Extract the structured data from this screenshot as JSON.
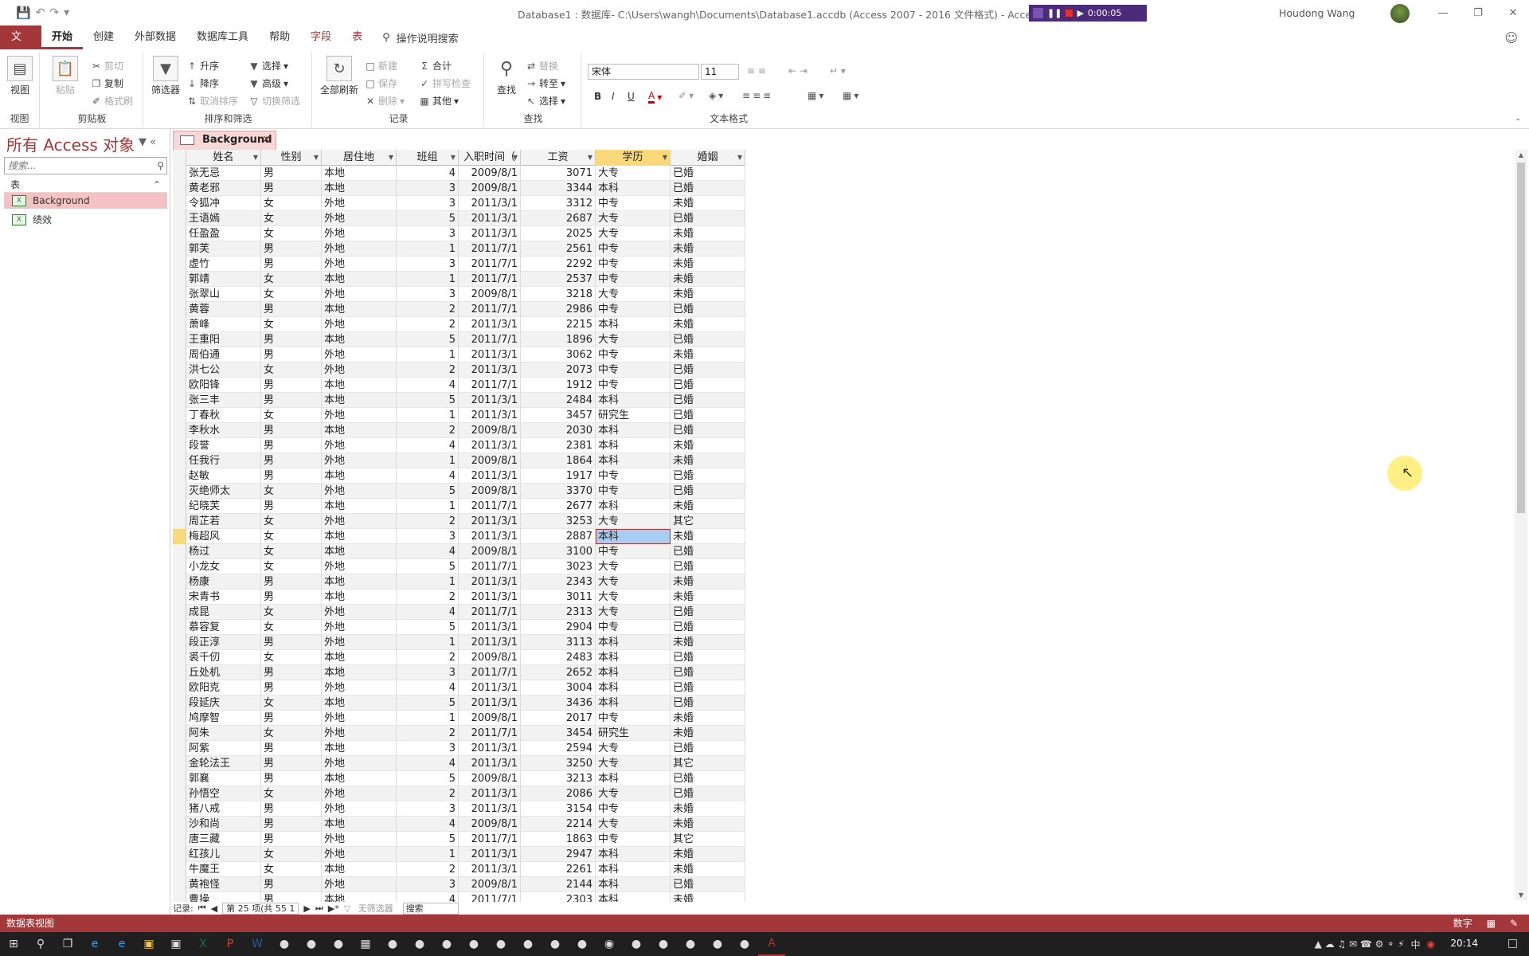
{
  "title": {
    "window_title": "Database1 : 数据库- C:\\Users\\wangh\\Documents\\Database1.accdb (Access 2007 - 2016 文件格式) - Access",
    "user": "Houdong Wang",
    "recorder_time": "0:00:05"
  },
  "menu": {
    "file": "文件",
    "tabs": [
      "开始",
      "创建",
      "外部数据",
      "数据库工具",
      "帮助",
      "字段",
      "表"
    ],
    "tell_me": "操作说明搜索"
  },
  "ribbon": {
    "view": {
      "btn": "视图",
      "label": "视图"
    },
    "clipboard": {
      "paste": "粘贴",
      "cut": "剪切",
      "copy": "复制",
      "format_painter": "格式刷",
      "label": "剪贴板"
    },
    "sort": {
      "filter": "筛选器",
      "asc": "升序",
      "desc": "降序",
      "clear_sort": "取消排序",
      "selection": "选择",
      "advanced": "高级",
      "toggle_filter": "切换筛选",
      "label": "排序和筛选"
    },
    "records": {
      "refresh": "全部刷新",
      "new": "新建",
      "save": "保存",
      "delete": "删除",
      "totals": "合计",
      "spelling": "拼写检查",
      "more": "其他",
      "label": "记录"
    },
    "find": {
      "find": "查找",
      "replace": "替换",
      "goto": "转至",
      "select": "选择",
      "label": "查找"
    },
    "text": {
      "font": "宋体",
      "size": "11",
      "label": "文本格式"
    }
  },
  "nav": {
    "title": "所有 Access 对象",
    "search_placeholder": "搜索...",
    "group": "表",
    "items": [
      "Background",
      "绩效"
    ]
  },
  "doc_tab": "Background",
  "table": {
    "columns": [
      "姓名",
      "性别",
      "居住地",
      "班组",
      "入职时间（",
      "工资",
      "学历",
      "婚姻"
    ],
    "rows": [
      [
        "张无忌",
        "男",
        "本地",
        "4",
        "2009/8/1",
        "3071",
        "大专",
        "已婚"
      ],
      [
        "黄老邪",
        "男",
        "本地",
        "3",
        "2009/8/1",
        "3344",
        "本科",
        "已婚"
      ],
      [
        "令狐冲",
        "女",
        "外地",
        "3",
        "2011/3/1",
        "3312",
        "中专",
        "未婚"
      ],
      [
        "王语嫣",
        "女",
        "外地",
        "5",
        "2011/3/1",
        "2687",
        "大专",
        "已婚"
      ],
      [
        "任盈盈",
        "女",
        "外地",
        "3",
        "2011/3/1",
        "2025",
        "大专",
        "未婚"
      ],
      [
        "郭芙",
        "男",
        "外地",
        "1",
        "2011/7/1",
        "2561",
        "中专",
        "未婚"
      ],
      [
        "虚竹",
        "男",
        "外地",
        "3",
        "2011/7/1",
        "2292",
        "中专",
        "未婚"
      ],
      [
        "郭靖",
        "女",
        "本地",
        "1",
        "2011/7/1",
        "2537",
        "中专",
        "未婚"
      ],
      [
        "张翠山",
        "女",
        "外地",
        "3",
        "2009/8/1",
        "3218",
        "大专",
        "未婚"
      ],
      [
        "黄蓉",
        "男",
        "本地",
        "2",
        "2011/7/1",
        "2986",
        "中专",
        "已婚"
      ],
      [
        "萧峰",
        "女",
        "外地",
        "2",
        "2011/3/1",
        "2215",
        "本科",
        "未婚"
      ],
      [
        "王重阳",
        "男",
        "本地",
        "5",
        "2011/7/1",
        "1896",
        "大专",
        "已婚"
      ],
      [
        "周伯通",
        "男",
        "外地",
        "1",
        "2011/3/1",
        "3062",
        "中专",
        "未婚"
      ],
      [
        "洪七公",
        "女",
        "外地",
        "2",
        "2011/3/1",
        "2073",
        "中专",
        "已婚"
      ],
      [
        "欧阳锋",
        "男",
        "本地",
        "4",
        "2011/7/1",
        "1912",
        "中专",
        "已婚"
      ],
      [
        "张三丰",
        "男",
        "本地",
        "5",
        "2011/3/1",
        "2484",
        "本科",
        "已婚"
      ],
      [
        "丁春秋",
        "女",
        "外地",
        "1",
        "2011/3/1",
        "3457",
        "研究生",
        "已婚"
      ],
      [
        "李秋水",
        "男",
        "本地",
        "2",
        "2009/8/1",
        "2030",
        "本科",
        "已婚"
      ],
      [
        "段誉",
        "男",
        "外地",
        "4",
        "2011/3/1",
        "2381",
        "本科",
        "未婚"
      ],
      [
        "任我行",
        "男",
        "外地",
        "1",
        "2009/8/1",
        "1864",
        "本科",
        "未婚"
      ],
      [
        "赵敏",
        "男",
        "本地",
        "4",
        "2011/3/1",
        "1917",
        "中专",
        "已婚"
      ],
      [
        "灭绝师太",
        "女",
        "外地",
        "5",
        "2009/8/1",
        "3370",
        "中专",
        "已婚"
      ],
      [
        "纪晓芙",
        "男",
        "本地",
        "1",
        "2011/7/1",
        "2677",
        "本科",
        "未婚"
      ],
      [
        "周芷若",
        "女",
        "外地",
        "2",
        "2011/3/1",
        "3253",
        "大专",
        "其它"
      ],
      [
        "梅超风",
        "女",
        "本地",
        "3",
        "2011/3/1",
        "2887",
        "本科",
        "未婚"
      ],
      [
        "杨过",
        "女",
        "本地",
        "4",
        "2009/8/1",
        "3100",
        "中专",
        "已婚"
      ],
      [
        "小龙女",
        "女",
        "外地",
        "5",
        "2011/7/1",
        "3023",
        "大专",
        "已婚"
      ],
      [
        "杨康",
        "男",
        "本地",
        "1",
        "2011/3/1",
        "2343",
        "大专",
        "未婚"
      ],
      [
        "宋青书",
        "男",
        "本地",
        "2",
        "2011/3/1",
        "3011",
        "大专",
        "未婚"
      ],
      [
        "成昆",
        "女",
        "外地",
        "4",
        "2011/7/1",
        "2313",
        "大专",
        "已婚"
      ],
      [
        "慕容复",
        "女",
        "外地",
        "5",
        "2011/3/1",
        "2904",
        "中专",
        "已婚"
      ],
      [
        "段正淳",
        "男",
        "外地",
        "1",
        "2011/3/1",
        "3113",
        "本科",
        "未婚"
      ],
      [
        "裘千仞",
        "女",
        "本地",
        "2",
        "2009/8/1",
        "2483",
        "本科",
        "已婚"
      ],
      [
        "丘处机",
        "男",
        "本地",
        "3",
        "2011/7/1",
        "2652",
        "本科",
        "已婚"
      ],
      [
        "欧阳克",
        "男",
        "外地",
        "4",
        "2011/3/1",
        "3004",
        "本科",
        "已婚"
      ],
      [
        "段延庆",
        "女",
        "本地",
        "5",
        "2011/3/1",
        "3436",
        "本科",
        "已婚"
      ],
      [
        "鸠摩智",
        "男",
        "外地",
        "1",
        "2009/8/1",
        "2017",
        "中专",
        "未婚"
      ],
      [
        "阿朱",
        "女",
        "外地",
        "2",
        "2011/7/1",
        "3454",
        "研究生",
        "未婚"
      ],
      [
        "阿紫",
        "男",
        "本地",
        "3",
        "2011/3/1",
        "2594",
        "大专",
        "已婚"
      ],
      [
        "金轮法王",
        "男",
        "外地",
        "4",
        "2011/3/1",
        "3250",
        "大专",
        "其它"
      ],
      [
        "郭襄",
        "男",
        "本地",
        "5",
        "2009/8/1",
        "3213",
        "本科",
        "已婚"
      ],
      [
        "孙悟空",
        "女",
        "外地",
        "2",
        "2011/3/1",
        "2086",
        "大专",
        "已婚"
      ],
      [
        "猪八戒",
        "男",
        "外地",
        "3",
        "2011/3/1",
        "3154",
        "中专",
        "未婚"
      ],
      [
        "沙和尚",
        "男",
        "本地",
        "4",
        "2009/8/1",
        "2214",
        "大专",
        "未婚"
      ],
      [
        "唐三藏",
        "男",
        "外地",
        "5",
        "2011/7/1",
        "1863",
        "中专",
        "其它"
      ],
      [
        "红孩儿",
        "女",
        "外地",
        "1",
        "2011/3/1",
        "2947",
        "本科",
        "未婚"
      ],
      [
        "牛魔王",
        "女",
        "本地",
        "2",
        "2011/3/1",
        "2261",
        "本科",
        "未婚"
      ],
      [
        "黄袍怪",
        "男",
        "外地",
        "3",
        "2009/8/1",
        "2144",
        "本科",
        "已婚"
      ],
      [
        "曹操",
        "男",
        "本地",
        "4",
        "2011/7/1",
        "2303",
        "本科",
        "未婚"
      ]
    ],
    "current_row": 24
  },
  "record_nav": {
    "label": "记录:",
    "current": "第 25 项(共 55 1",
    "no_filter": "无筛选器",
    "search": "搜索"
  },
  "status": {
    "left": "数据表视图",
    "numlock": "数字"
  },
  "taskbar": {
    "ime": "中",
    "time": "20:14"
  }
}
